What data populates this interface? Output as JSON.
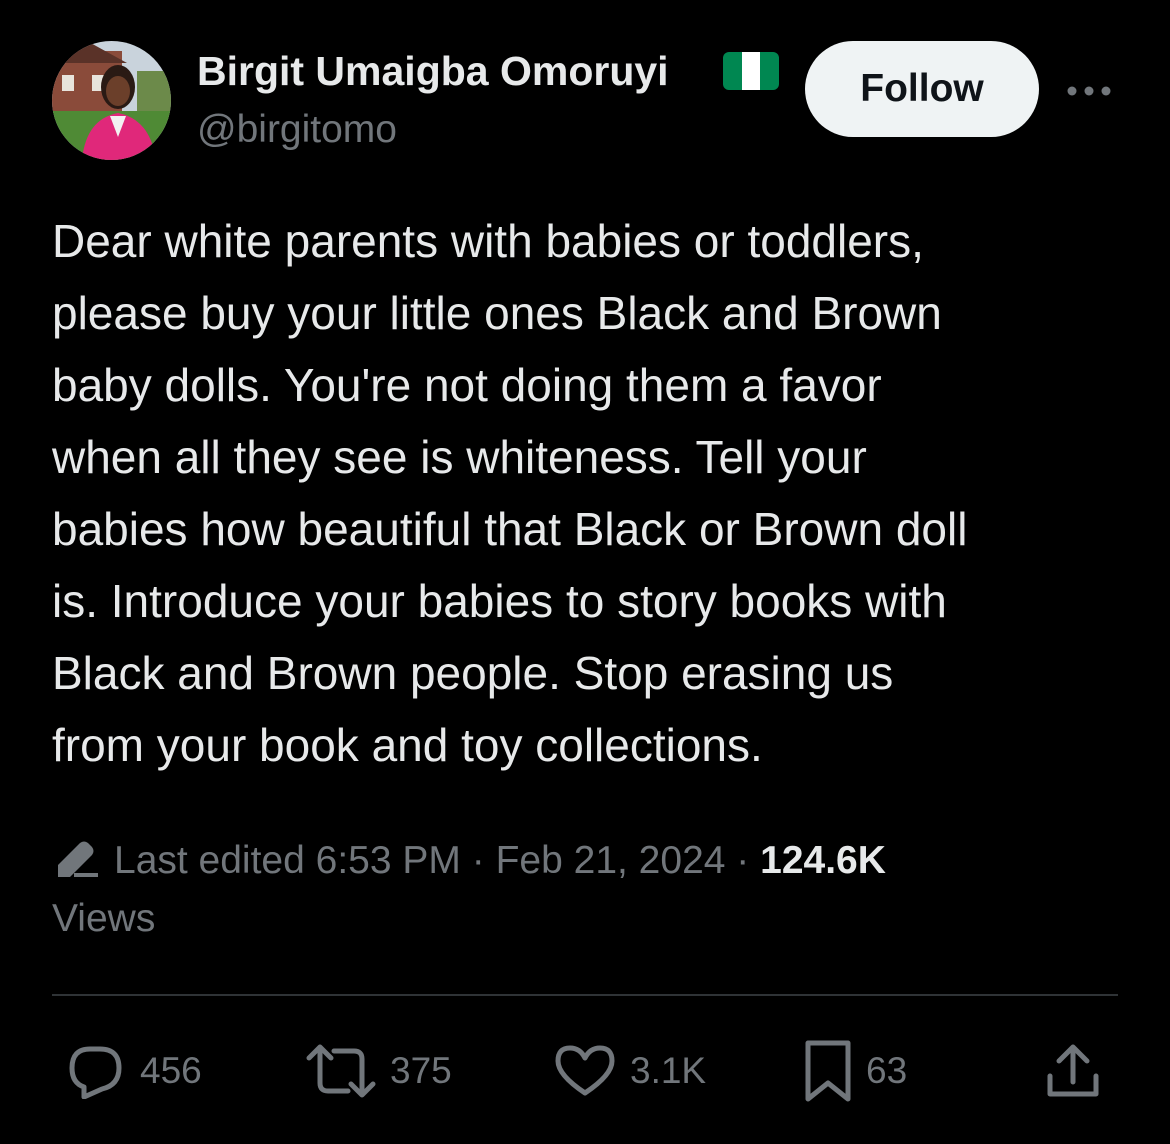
{
  "author": {
    "display_name": "Birgit Umaigba Omoruyi",
    "handle": "@birgitomo",
    "flag_icon": "nigeria-flag-icon",
    "flag_colors": [
      "#008751",
      "#ffffff",
      "#008751"
    ]
  },
  "follow_label": "Follow",
  "more_icon": "more-horizontal-icon",
  "tweet_text_lines": [
    "Dear white parents with babies or toddlers,",
    "please buy your little ones Black and Brown",
    "baby dolls. You're not doing them a favor",
    "when all they see is whiteness. Tell your",
    "babies how beautiful that Black or Brown doll",
    "is. Introduce your babies to story books with",
    "Black and Brown people. Stop erasing us",
    "from your book and toy collections."
  ],
  "meta": {
    "edit_icon": "pencil-icon",
    "edited_label": "Last edited",
    "time": "6:53 PM",
    "separator": "·",
    "date": "Feb 21, 2024",
    "views_count": "124.6K",
    "views_label": "Views"
  },
  "actions": {
    "replies": {
      "icon": "reply-icon",
      "count": "456"
    },
    "reposts": {
      "icon": "repost-icon",
      "count": "375"
    },
    "likes": {
      "icon": "heart-icon",
      "count": "3.1K"
    },
    "bookmarks": {
      "icon": "bookmark-icon",
      "count": "63"
    },
    "share": {
      "icon": "share-icon"
    }
  },
  "colors": {
    "background": "#000000",
    "primary_text": "#e7e9ea",
    "secondary_text": "#71767b",
    "follow_button_bg": "#eff3f4",
    "divider": "#2f3336"
  }
}
